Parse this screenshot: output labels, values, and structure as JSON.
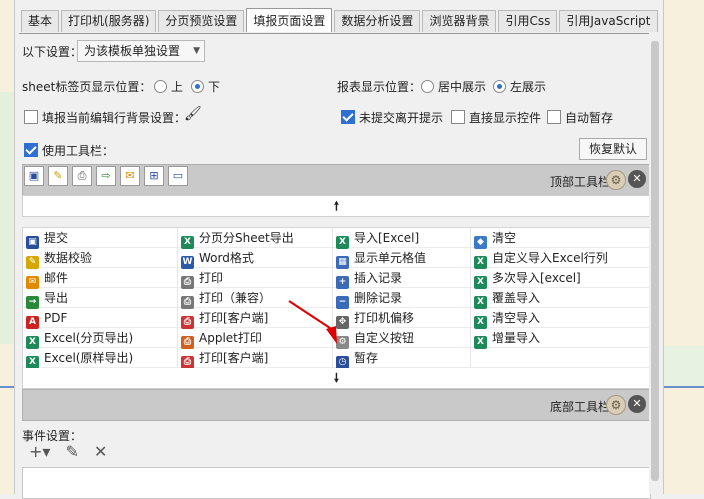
{
  "tabs": [
    "基本",
    "打印机(服务器)",
    "分页预览设置",
    "填报页面设置",
    "数据分析设置",
    "浏览器背景",
    "引用Css",
    "引用JavaScript"
  ],
  "active_tab_index": 3,
  "settings": {
    "apply_label": "以下设置：",
    "apply_value": "为该模板单独设置",
    "sheet_tab_label": "sheet标签页显示位置：",
    "sheet_tab_options": [
      "上",
      "下"
    ],
    "sheet_tab_selected": "下",
    "report_pos_label": "报表显示位置：",
    "report_pos_options": [
      "居中展示",
      "左展示"
    ],
    "report_pos_selected": "左展示",
    "fill_bg_label": "填报当前编辑行背景设置：",
    "unsubmitted_label": "未提交离开提示",
    "direct_show_label": "直接显示控件",
    "autosave_label": "自动暂存",
    "use_toolbar_label": "使用工具栏：",
    "restore_button": "恢复默认"
  },
  "checkboxes": {
    "fill_bg": false,
    "unsubmitted": true,
    "direct_show": false,
    "autosave": false,
    "use_toolbar": true
  },
  "top_toolbar_label": "顶部工具栏",
  "bottom_toolbar_label": "底部工具栏",
  "tools": [
    [
      "提交",
      "分页分Sheet导出",
      "导入[Excel]",
      "清空"
    ],
    [
      "数据校验",
      "Word格式",
      "显示单元格值",
      "自定义导入Excel行列"
    ],
    [
      "邮件",
      "打印",
      "插入记录",
      "多次导入[excel]"
    ],
    [
      "导出",
      "打印（兼容）",
      "删除记录",
      "覆盖导入"
    ],
    [
      "PDF",
      "打印[客户端]",
      "打印机偏移",
      "清空导入"
    ],
    [
      "Excel(分页导出)",
      "Applet打印",
      "自定义按钮",
      "增量导入"
    ],
    [
      "Excel(原样导出)",
      "打印[客户端]",
      "暂存",
      ""
    ]
  ],
  "tool_icons": [
    [
      "save-icon",
      "excel-icon",
      "excel-icon",
      "eraser-icon"
    ],
    [
      "check-icon",
      "word-icon",
      "grid-icon",
      "excel-icon"
    ],
    [
      "mail-icon",
      "print-icon",
      "insert-row-icon",
      "excel-icon"
    ],
    [
      "export-icon",
      "print-icon",
      "delete-row-icon",
      "excel-icon"
    ],
    [
      "pdf-icon",
      "print-client-icon",
      "move-icon",
      "excel-icon"
    ],
    [
      "excel-icon",
      "applet-print-icon",
      "gear-icon",
      "excel-icon"
    ],
    [
      "excel-icon",
      "print-client-icon",
      "temp-save-icon",
      ""
    ]
  ],
  "events_label": "事件设置："
}
